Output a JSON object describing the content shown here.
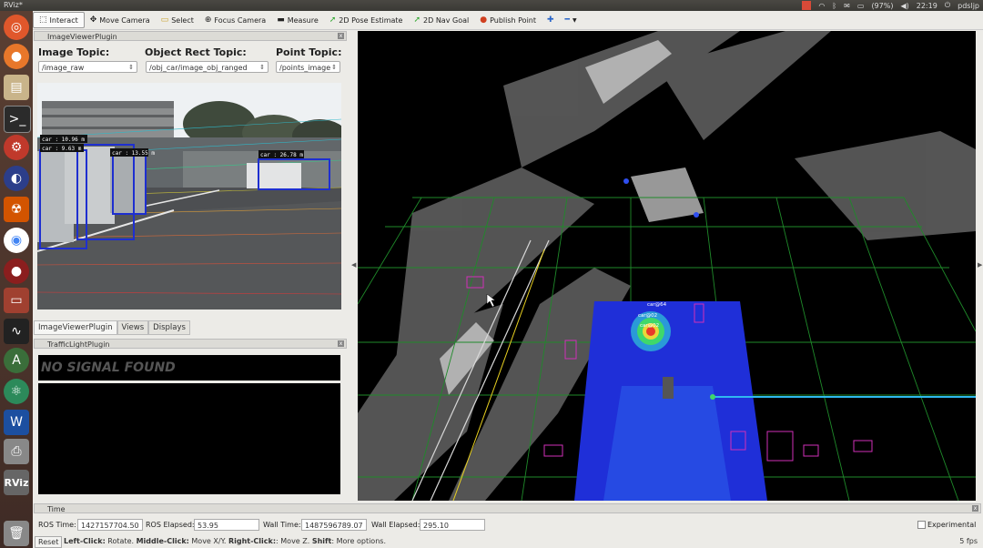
{
  "window_title": "RViz*",
  "tray": {
    "battery": "(97%)",
    "time": "22:19",
    "user": "pdsljp"
  },
  "toolbar": {
    "tools": [
      {
        "label": "Interact",
        "icon": "cursor-icon",
        "active": true
      },
      {
        "label": "Move Camera",
        "icon": "move-icon"
      },
      {
        "label": "Select",
        "icon": "select-icon"
      },
      {
        "label": "Focus Camera",
        "icon": "focus-icon"
      },
      {
        "label": "Measure",
        "icon": "ruler-icon"
      },
      {
        "label": "2D Pose Estimate",
        "icon": "pose-arrow-icon"
      },
      {
        "label": "2D Nav Goal",
        "icon": "nav-arrow-icon"
      },
      {
        "label": "Publish Point",
        "icon": "pin-icon"
      }
    ]
  },
  "image_viewer": {
    "panel_title": "ImageViewerPlugin",
    "image_topic_label": "Image Topic:",
    "image_topic_value": "/image_raw",
    "object_topic_label": "Object Rect Topic:",
    "object_topic_value": "/obj_car/image_obj_ranged",
    "point_topic_label": "Point Topic:",
    "point_topic_value": "/points_image",
    "detections": [
      "car : 10.96 m",
      "car : 9.63 m",
      "car : 13.55 m",
      "car : 26.78 m"
    ]
  },
  "left_tabs": [
    "ImageViewerPlugin",
    "Views",
    "Displays"
  ],
  "traffic_light": {
    "panel_title": "TrafficLightPlugin",
    "status": "NO SIGNAL FOUND"
  },
  "viewport_labels": [
    "car@64",
    "car@02",
    "car@02"
  ],
  "time_panel": {
    "title": "Time",
    "ros_time_label": "ROS Time:",
    "ros_time": "1427157704.50",
    "ros_elapsed_label": "ROS Elapsed:",
    "ros_elapsed": "53.95",
    "wall_time_label": "Wall Time:",
    "wall_time": "1487596789.07",
    "wall_elapsed_label": "Wall Elapsed:",
    "wall_elapsed": "295.10",
    "experimental_label": "Experimental"
  },
  "status_bar": {
    "reset_label": "Reset",
    "hint_left_key": "Left-Click:",
    "hint_left": " Rotate. ",
    "hint_mid_key": "Middle-Click:",
    "hint_mid": " Move X/Y. ",
    "hint_right_key": "Right-Click:",
    "hint_right": ": Move Z. ",
    "hint_shift_key": "Shift",
    "hint_shift": ": More options.",
    "fps": "5 fps"
  }
}
